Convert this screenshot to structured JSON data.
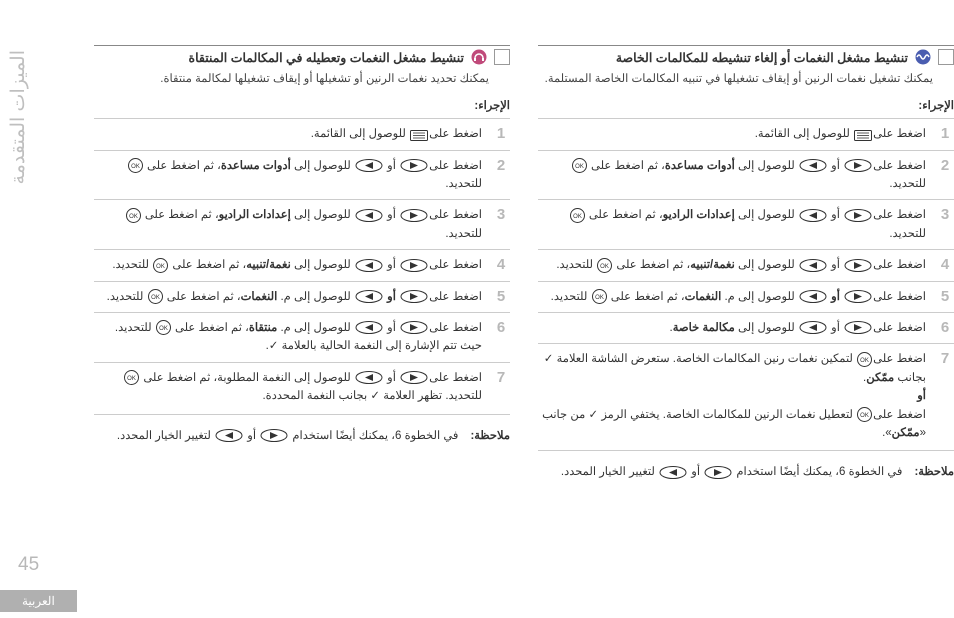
{
  "sidebar_title": "الميزات المتقدمة",
  "page_number": "45",
  "language_tab": "العربية",
  "right_col": {
    "title": "تنشيط مشغل النغمات أو إلغاء تنشيطه للمكالمات الخاصة",
    "desc": "يمكنك تشغيل نغمات الرنين أو إيقاف تشغيلها في تنبيه المكالمات الخاصة المستلمة.",
    "procedure_label": "الإجراء:",
    "steps": {
      "s1": " للوصول إلى القائمة.",
      "s2a": " أو ",
      "s2b": " للوصول إلى ",
      "s2bold": "أدوات مساعدة",
      "s2c": "، ثم اضغط على ",
      "s2d": " للتحديد.",
      "s3a": " أو ",
      "s3b": " للوصول إلى ",
      "s3bold": "إعدادات الراديو",
      "s3c": "، ثم اضغط على ",
      "s3d": " للتحديد.",
      "s4a": " أو ",
      "s4b": " للوصول إلى ",
      "s4bold": "نغمة/تنبيه",
      "s4c": "، ثم اضغط على ",
      "s4d": " للتحديد.",
      "s5or": " أو ",
      "s5b": " للوصول إلى م. ",
      "s5bold": "النغمات",
      "s5c": "، ثم اضغط على ",
      "s5d": " للتحديد.",
      "s6a": " أو ",
      "s6b": " للوصول إلى ",
      "s6bold": "مكالمة خاصة",
      "s6c": ".",
      "s7a": " لتمكين نغمات رنين المكالمات الخاصة. ستعرض الشاشة العلامة ",
      "s7b": " بجانب ",
      "s7bold1": "ممّكن",
      "s7c": ".",
      "s7or": "أو",
      "s7d": " لتعطيل نغمات الرنين للمكالمات الخاصة. يختفي الرمز ",
      "s7e": " من جانب «",
      "s7bold2": "ممّكن",
      "s7f": "».",
      "press": "اضغط على"
    },
    "note_label": "ملاحظة:",
    "note_text_a": "في الخطوة 6، يمكنك أيضًا استخدام ",
    "note_text_b": " أو ",
    "note_text_c": " لتغيير الخيار المحدد."
  },
  "left_col": {
    "title": "تنشيط مشغل النغمات وتعطيله في المكالمات المنتقاة",
    "desc": "يمكنك تحديد نغمات الرنين أو تشغيلها أو إيقاف تشغيلها لمكالمة منتقاة.",
    "procedure_label": "الإجراء:",
    "steps": {
      "press": "اضغط على",
      "s1": " للوصول إلى القائمة.",
      "s2a": " أو ",
      "s2b": " للوصول إلى ",
      "s2bold": "أدوات مساعدة",
      "s2c": "، ثم اضغط على ",
      "s2d": " للتحديد.",
      "s3a": " أو ",
      "s3b": " للوصول إلى ",
      "s3bold": "إعدادات الراديو",
      "s3c": "، ثم اضغط على ",
      "s3d": " للتحديد.",
      "s4a": " أو ",
      "s4b": " للوصول إلى ",
      "s4bold": "نغمة/تنبيه",
      "s4c": "، ثم اضغط على ",
      "s4d": " للتحديد.",
      "s5or": " أو ",
      "s5b": " للوصول إلى م. ",
      "s5bold": "النغمات",
      "s5c": "، ثم اضغط على ",
      "s5d": " للتحديد.",
      "s6a": " أو ",
      "s6b": " للوصول إلى م. ",
      "s6bold": "منتقاة",
      "s6c": "، ثم اضغط على ",
      "s6d": " للتحديد.",
      "s6e": "حيث تتم الإشارة إلى النغمة الحالية بالعلامة ",
      "s7a": " أو ",
      "s7b": " للوصول إلى النغمة المطلوبة، ثم اضغط على ",
      "s7c": " للتحديد. تظهر العلامة ",
      "s7d": " بجانب النغمة المحددة."
    },
    "note_label": "ملاحظة:",
    "note_text_a": "في الخطوة 6، يمكنك أيضًا استخدام ",
    "note_text_b": " أو ",
    "note_text_c": " لتغيير الخيار المحدد."
  }
}
